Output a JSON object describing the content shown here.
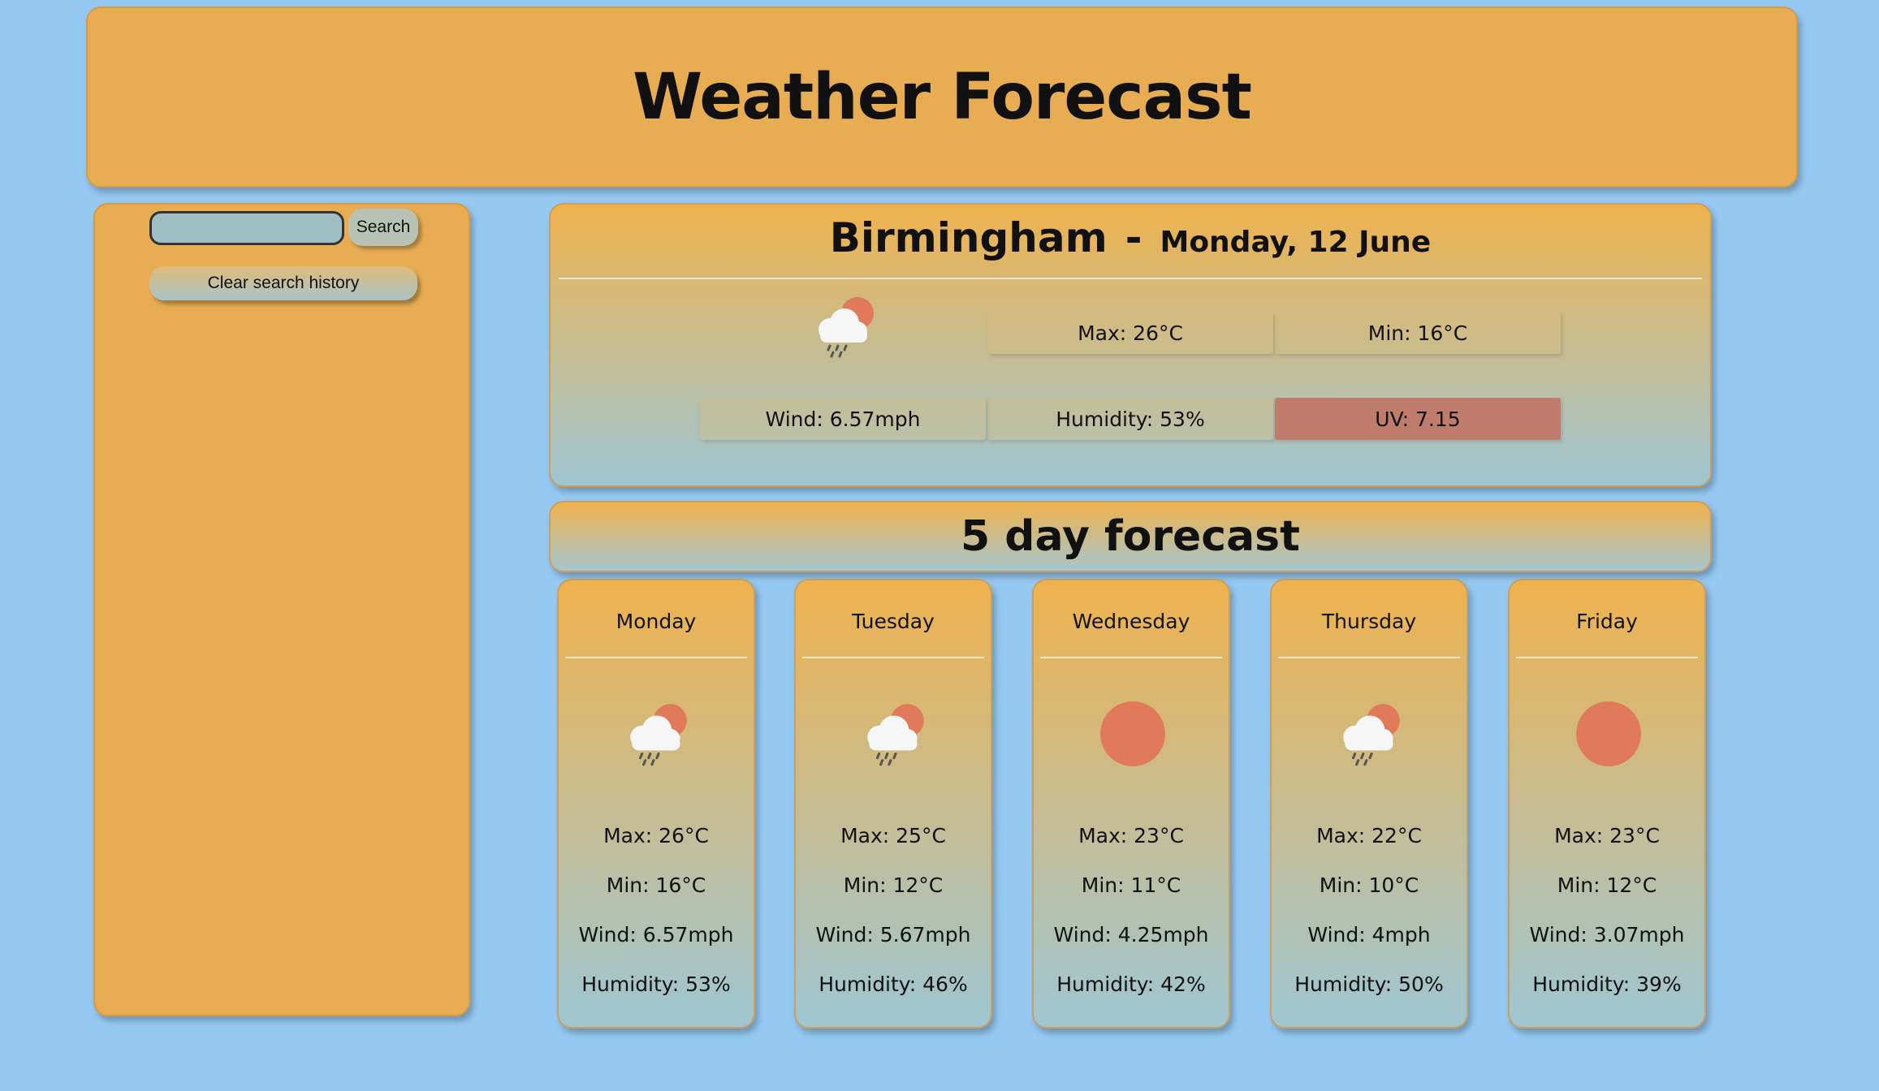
{
  "header": {
    "title": "Weather Forecast"
  },
  "search": {
    "input_value": "",
    "button_label": "Search",
    "clear_label": "Clear search history"
  },
  "current": {
    "city": "Birmingham",
    "separator": "-",
    "date": "Monday, 12 June",
    "icon": "sun-cloud-rain-icon",
    "max": "Max: 26°C",
    "min": "Min: 16°C",
    "wind": "Wind: 6.57mph",
    "humidity": "Humidity: 53%",
    "uv": "UV: 7.15",
    "uv_color": "#bf7b6c"
  },
  "forecast": {
    "title": "5 day forecast",
    "days": [
      {
        "name": "Monday",
        "icon": "sun-cloud-rain-icon",
        "max": "Max: 26°C",
        "min": "Min: 16°C",
        "wind": "Wind: 6.57mph",
        "humidity": "Humidity: 53%"
      },
      {
        "name": "Tuesday",
        "icon": "sun-cloud-rain-icon",
        "max": "Max: 25°C",
        "min": "Min: 12°C",
        "wind": "Wind: 5.67mph",
        "humidity": "Humidity: 46%"
      },
      {
        "name": "Wednesday",
        "icon": "sun-icon",
        "max": "Max: 23°C",
        "min": "Min: 11°C",
        "wind": "Wind: 4.25mph",
        "humidity": "Humidity: 42%"
      },
      {
        "name": "Thursday",
        "icon": "sun-cloud-rain-icon",
        "max": "Max: 22°C",
        "min": "Min: 10°C",
        "wind": "Wind: 4mph",
        "humidity": "Humidity: 50%"
      },
      {
        "name": "Friday",
        "icon": "sun-icon",
        "max": "Max: 23°C",
        "min": "Min: 12°C",
        "wind": "Wind: 3.07mph",
        "humidity": "Humidity: 39%"
      }
    ]
  },
  "colors": {
    "background": "#96c9f2",
    "panel": "#e8ad52",
    "sun": "#e07a5a"
  }
}
